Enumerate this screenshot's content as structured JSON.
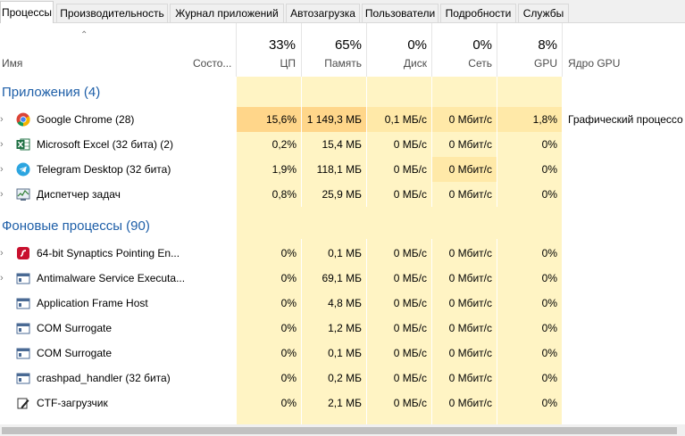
{
  "tabs": [
    "Процессы",
    "Производительность",
    "Журнал приложений",
    "Автозагрузка",
    "Пользователи",
    "Подробности",
    "Службы"
  ],
  "columns": {
    "name": "Имя",
    "status": "Состо...",
    "cpu": {
      "pct": "33%",
      "label": "ЦП"
    },
    "mem": {
      "pct": "65%",
      "label": "Память"
    },
    "disk": {
      "pct": "0%",
      "label": "Диск"
    },
    "net": {
      "pct": "0%",
      "label": "Сеть"
    },
    "gpu": {
      "pct": "8%",
      "label": "GPU"
    },
    "gpu_engine": "Ядро GPU"
  },
  "groups": {
    "apps": "Приложения (4)",
    "background": "Фоновые процессы (90)"
  },
  "apps": [
    {
      "name": "Google Chrome (28)",
      "icon": "chrome-icon",
      "expand": true,
      "cpu": "15,6%",
      "mem": "1 149,3 МБ",
      "disk": "0,1 МБ/с",
      "net": "0 Мбит/с",
      "gpu": "1,8%",
      "engine": "Графический процессо"
    },
    {
      "name": "Microsoft Excel (32 бита) (2)",
      "icon": "excel-icon",
      "expand": true,
      "cpu": "0,2%",
      "mem": "15,4 МБ",
      "disk": "0 МБ/с",
      "net": "0 Мбит/с",
      "gpu": "0%",
      "engine": ""
    },
    {
      "name": "Telegram Desktop (32 бита)",
      "icon": "telegram-icon",
      "expand": true,
      "cpu": "1,9%",
      "mem": "118,1 МБ",
      "disk": "0 МБ/с",
      "net": "0 Мбит/с",
      "gpu": "0%",
      "engine": ""
    },
    {
      "name": "Диспетчер задач",
      "icon": "task-manager-icon",
      "expand": true,
      "cpu": "0,8%",
      "mem": "25,9 МБ",
      "disk": "0 МБ/с",
      "net": "0 Мбит/с",
      "gpu": "0%",
      "engine": ""
    }
  ],
  "background": [
    {
      "name": "64-bit Synaptics Pointing En...",
      "icon": "synaptics-icon",
      "expand": true,
      "cpu": "0%",
      "mem": "0,1 МБ",
      "disk": "0 МБ/с",
      "net": "0 Мбит/с",
      "gpu": "0%"
    },
    {
      "name": "Antimalware Service Executa...",
      "icon": "service-icon",
      "expand": true,
      "cpu": "0%",
      "mem": "69,1 МБ",
      "disk": "0 МБ/с",
      "net": "0 Мбит/с",
      "gpu": "0%"
    },
    {
      "name": "Application Frame Host",
      "icon": "window-icon",
      "expand": false,
      "cpu": "0%",
      "mem": "4,8 МБ",
      "disk": "0 МБ/с",
      "net": "0 Мбит/с",
      "gpu": "0%"
    },
    {
      "name": "COM Surrogate",
      "icon": "window-icon",
      "expand": false,
      "cpu": "0%",
      "mem": "1,2 МБ",
      "disk": "0 МБ/с",
      "net": "0 Мбит/с",
      "gpu": "0%"
    },
    {
      "name": "COM Surrogate",
      "icon": "window-icon",
      "expand": false,
      "cpu": "0%",
      "mem": "0,1 МБ",
      "disk": "0 МБ/с",
      "net": "0 Мбит/с",
      "gpu": "0%"
    },
    {
      "name": "crashpad_handler (32 бита)",
      "icon": "window-icon",
      "expand": false,
      "cpu": "0%",
      "mem": "0,2 МБ",
      "disk": "0 МБ/с",
      "net": "0 Мбит/с",
      "gpu": "0%"
    },
    {
      "name": "CTF-загрузчик",
      "icon": "ctf-icon",
      "expand": false,
      "cpu": "0%",
      "mem": "2,1 МБ",
      "disk": "0 МБ/с",
      "net": "0 Мбит/с",
      "gpu": "0%"
    }
  ],
  "colors": {
    "col_light": "#fff4c4",
    "col_medium": "#ffe9a8",
    "col_strong": "#ffd68a",
    "group_text": "#1e5fa8"
  }
}
